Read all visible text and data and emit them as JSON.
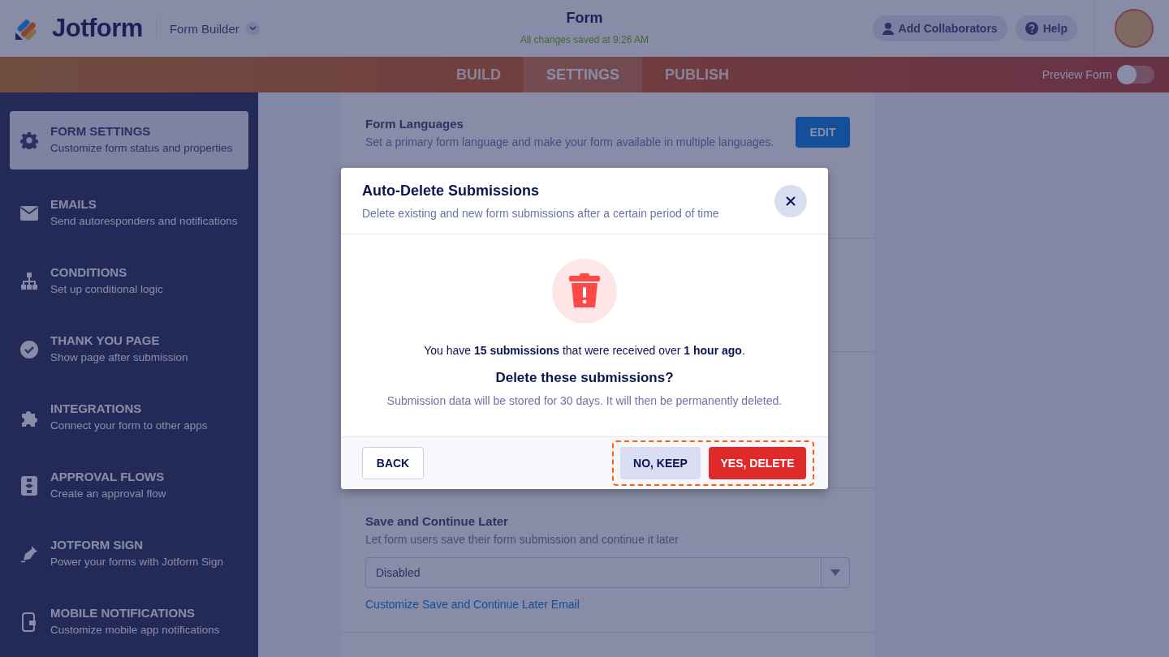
{
  "header": {
    "logo": "Jotform",
    "product": "Form Builder",
    "title": "Form",
    "save_status": "All changes saved at 9:26 AM",
    "buttons": [
      {
        "label": "Add Collaborators",
        "kind": "user"
      },
      {
        "label": "Help",
        "kind": "help"
      }
    ]
  },
  "tabs": [
    {
      "label": "BUILD",
      "selected": false
    },
    {
      "label": "SETTINGS",
      "selected": true
    },
    {
      "label": "PUBLISH",
      "selected": false
    }
  ],
  "preview": {
    "label": "Preview Form",
    "on": false
  },
  "sidebar": {
    "items": [
      {
        "kind": "gear",
        "title": "FORM SETTINGS",
        "subtitle": "Customize form status and properties",
        "selected": true
      },
      {
        "kind": "mail",
        "title": "EMAILS",
        "subtitle": "Send autoresponders and notifications",
        "selected": false
      },
      {
        "kind": "tree",
        "title": "CONDITIONS",
        "subtitle": "Set up conditional logic",
        "selected": false
      },
      {
        "kind": "check",
        "title": "THANK YOU PAGE",
        "subtitle": "Show page after submission",
        "selected": false
      },
      {
        "kind": "puzzle",
        "title": "INTEGRATIONS",
        "subtitle": "Connect your form to other apps",
        "selected": false
      },
      {
        "kind": "flow",
        "title": "APPROVAL FLOWS",
        "subtitle": "Create an approval flow",
        "selected": false
      },
      {
        "kind": "pen",
        "title": "JOTFORM SIGN",
        "subtitle": "Power your forms with Jotform Sign",
        "selected": false
      },
      {
        "kind": "phone",
        "title": "MOBILE NOTIFICATIONS",
        "subtitle": "Customize mobile app notifications",
        "selected": false
      }
    ]
  },
  "settings": [
    {
      "kind": "button",
      "title": "Form Languages",
      "description": "Set a primary form language and make your form available in multiple languages.",
      "button": "EDIT"
    },
    {
      "kind": "select",
      "title": "Save and Continue Later",
      "description": "Let form users save their form submission and continue it later",
      "value": "Disabled",
      "link": "Customize Save and Continue Later Email"
    }
  ],
  "dialog": {
    "title": "Auto-Delete Submissions",
    "subtitle": "Delete existing and new form submissions after a certain period of time",
    "message": "You have **15 submissions** that were received over **1 hour ago**.",
    "question": "Delete these submissions?",
    "note": "Submission data will be stored for 30 days. It will then be permanently deleted.",
    "back": "BACK",
    "cancel": "NO, KEEP",
    "confirm": "YES, DELETE"
  }
}
